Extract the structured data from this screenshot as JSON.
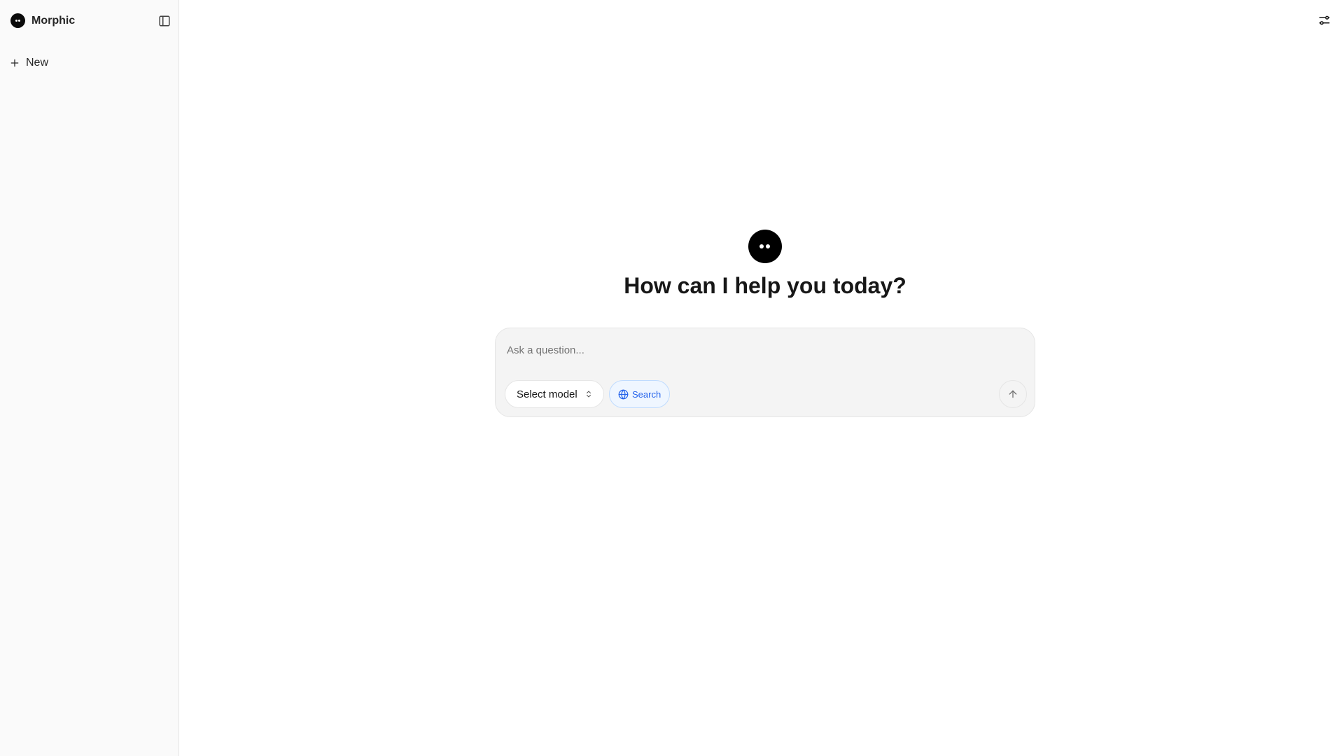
{
  "sidebar": {
    "brand_name": "Morphic",
    "new_label": "New"
  },
  "main": {
    "heading": "How can I help you today?",
    "composer": {
      "placeholder": "Ask a question...",
      "value": "",
      "model_select_label": "Select model",
      "search_label": "Search"
    }
  },
  "icons": {
    "brand": "morphic-logo-icon",
    "sidebar_toggle": "panel-left-icon",
    "new": "plus-icon",
    "settings": "sliders-icon",
    "model_select": "chevrons-up-down-icon",
    "search": "globe-icon",
    "send": "arrow-up-icon"
  },
  "colors": {
    "sidebar_bg": "#fafafa",
    "composer_bg": "#f4f4f4",
    "search_accent": "#2563eb",
    "search_bg": "#eff6ff",
    "logo": "#000000"
  }
}
